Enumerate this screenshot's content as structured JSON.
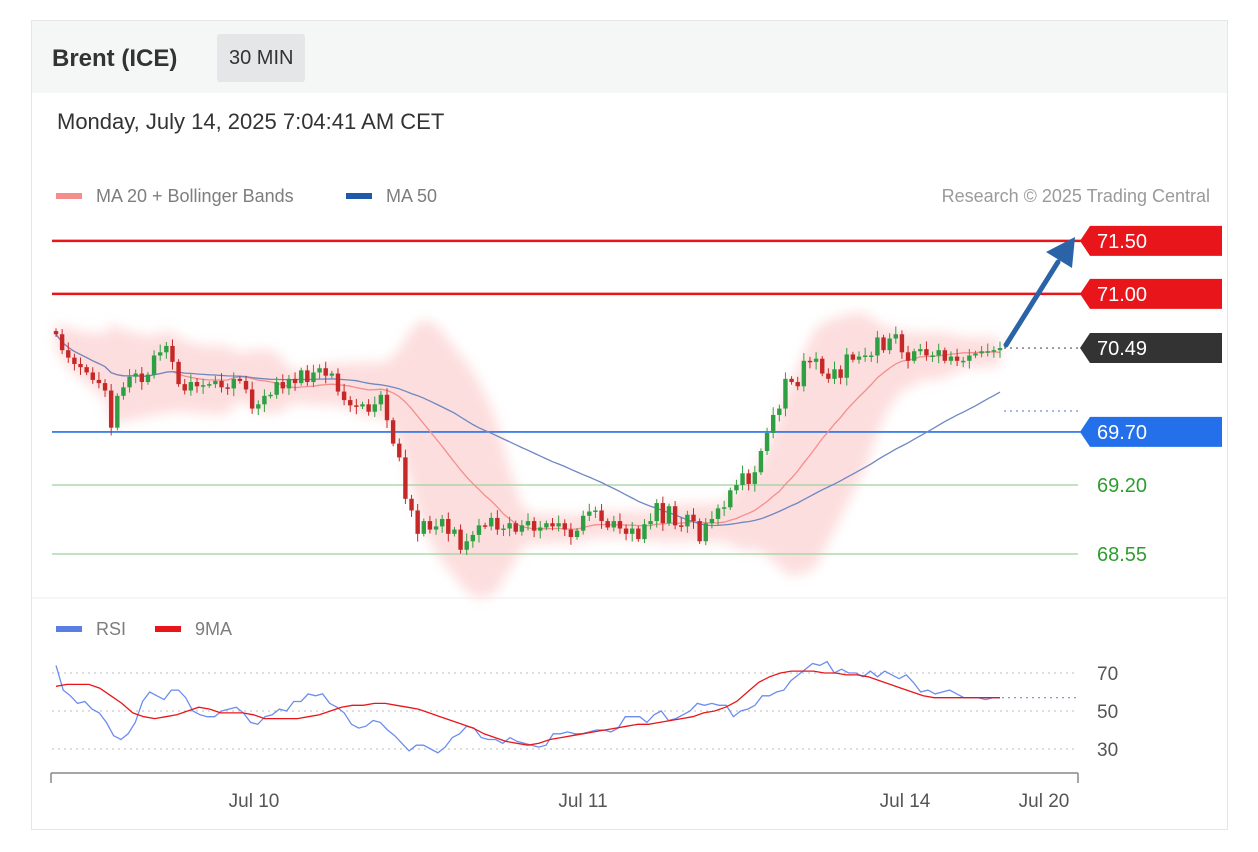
{
  "header": {
    "instrument": "Brent (ICE)",
    "timeframe": "30 MIN",
    "timestamp": "Monday, July 14, 2025 7:04:41 AM CET"
  },
  "chart_data": {
    "type": "candlestick",
    "legend": [
      "MA 20 + Bollinger Bands",
      "MA 50"
    ],
    "credit": "Research © 2025 Trading Central",
    "levels": [
      {
        "value": 71.5,
        "label": "71.50",
        "kind": "resistance",
        "color": "#e8161b"
      },
      {
        "value": 71.0,
        "label": "71.00",
        "kind": "resistance",
        "color": "#e8161b"
      },
      {
        "value": 70.49,
        "label": "70.49",
        "kind": "last",
        "color": "#333333"
      },
      {
        "value": 69.7,
        "label": "69.70",
        "kind": "pivot",
        "color": "#2470ea"
      },
      {
        "value": 69.2,
        "label": "69.20",
        "kind": "support",
        "color": "#2e9e2e"
      },
      {
        "value": 68.55,
        "label": "68.55",
        "kind": "support",
        "color": "#2e9e2e"
      }
    ],
    "x_ticks": [
      "Jul 10",
      "Jul 11",
      "Jul 14",
      "Jul 20"
    ],
    "price_closes": [
      70.62,
      70.47,
      70.4,
      70.34,
      70.31,
      70.26,
      70.19,
      70.16,
      70.09,
      69.74,
      70.04,
      70.12,
      70.22,
      70.25,
      70.17,
      70.24,
      70.42,
      70.45,
      70.51,
      70.36,
      70.15,
      70.09,
      70.17,
      70.13,
      70.14,
      70.15,
      70.18,
      70.12,
      70.11,
      70.2,
      70.18,
      70.1,
      69.92,
      69.96,
      70.04,
      70.05,
      70.17,
      70.11,
      70.2,
      70.16,
      70.28,
      70.17,
      70.26,
      70.3,
      70.23,
      70.25,
      70.08,
      70.0,
      69.95,
      69.94,
      69.96,
      69.89,
      69.96,
      70.05,
      69.81,
      69.59,
      69.46,
      69.07,
      68.96,
      68.74,
      68.86,
      68.78,
      68.81,
      68.88,
      68.74,
      68.78,
      68.59,
      68.67,
      68.73,
      68.82,
      68.81,
      68.89,
      68.78,
      68.79,
      68.84,
      68.76,
      68.82,
      68.86,
      68.77,
      68.8,
      68.84,
      68.81,
      68.84,
      68.78,
      68.71,
      68.77,
      68.91,
      68.95,
      68.96,
      68.86,
      68.8,
      68.86,
      68.79,
      68.74,
      68.79,
      68.69,
      68.83,
      68.86,
      69.03,
      68.84,
      69.0,
      68.82,
      68.81,
      68.92,
      68.86,
      68.67,
      68.84,
      68.88,
      68.98,
      68.99,
      69.15,
      69.2,
      69.31,
      69.21,
      69.32,
      69.52,
      69.69,
      69.86,
      69.92,
      70.2,
      70.17,
      70.13,
      70.37,
      70.36,
      70.39,
      70.25,
      70.2,
      70.29,
      70.21,
      70.43,
      70.38,
      70.41,
      70.42,
      70.42,
      70.59,
      70.47,
      70.58,
      70.62,
      70.45,
      70.37,
      70.46,
      70.48,
      70.42,
      70.42,
      70.47,
      70.37,
      70.41,
      70.37,
      70.37,
      70.42,
      70.44,
      70.46,
      70.46,
      70.47,
      70.49
    ],
    "rsi": {
      "series": [
        "RSI",
        "9MA"
      ],
      "levels": [
        70,
        50,
        30
      ],
      "last": 57,
      "rsi_values": [
        74,
        61,
        58,
        54,
        55,
        51,
        49,
        44,
        37,
        35,
        38,
        44,
        55,
        60,
        58,
        56,
        61,
        61,
        57,
        50,
        48,
        47,
        47,
        50,
        51,
        52,
        49,
        44,
        43,
        47,
        48,
        51,
        50,
        55,
        55,
        59,
        58,
        59,
        54,
        52,
        49,
        43,
        41,
        42,
        45,
        44,
        40,
        37,
        33,
        29,
        32,
        32,
        30,
        28,
        31,
        36,
        38,
        42,
        41,
        36,
        35,
        35,
        33,
        36,
        34,
        33,
        32,
        31,
        32,
        38,
        38,
        39,
        38,
        38,
        39,
        40,
        40,
        39,
        41,
        47,
        47,
        47,
        44,
        48,
        50,
        45,
        46,
        48,
        50,
        54,
        53,
        54,
        53,
        53,
        47,
        50,
        51,
        53,
        58,
        58,
        60,
        61,
        66,
        69,
        72,
        75,
        74,
        76,
        70,
        72,
        70,
        70,
        68,
        71,
        68,
        71,
        69,
        67,
        69,
        65,
        60,
        61,
        59,
        60,
        61,
        59,
        57,
        57,
        57,
        56,
        57,
        57
      ],
      "ma_values": [
        63,
        64,
        64,
        64,
        62,
        58,
        54,
        49,
        47,
        46,
        47,
        48,
        50,
        52,
        51,
        49,
        49,
        49,
        48,
        46,
        46,
        46,
        46,
        47,
        48,
        50,
        52,
        53,
        53,
        54,
        54,
        53,
        52,
        51,
        49,
        47,
        45,
        43,
        41,
        38,
        36,
        34,
        33,
        32,
        33,
        35,
        36,
        37,
        38,
        39,
        40,
        41,
        42,
        43,
        43,
        44,
        45,
        46,
        47,
        49,
        50,
        52,
        55,
        60,
        65,
        68,
        70,
        71,
        71,
        71,
        70,
        70,
        69,
        69,
        68,
        66,
        64,
        62,
        60,
        58,
        57,
        57,
        57,
        57,
        57,
        57,
        57
      ]
    }
  }
}
